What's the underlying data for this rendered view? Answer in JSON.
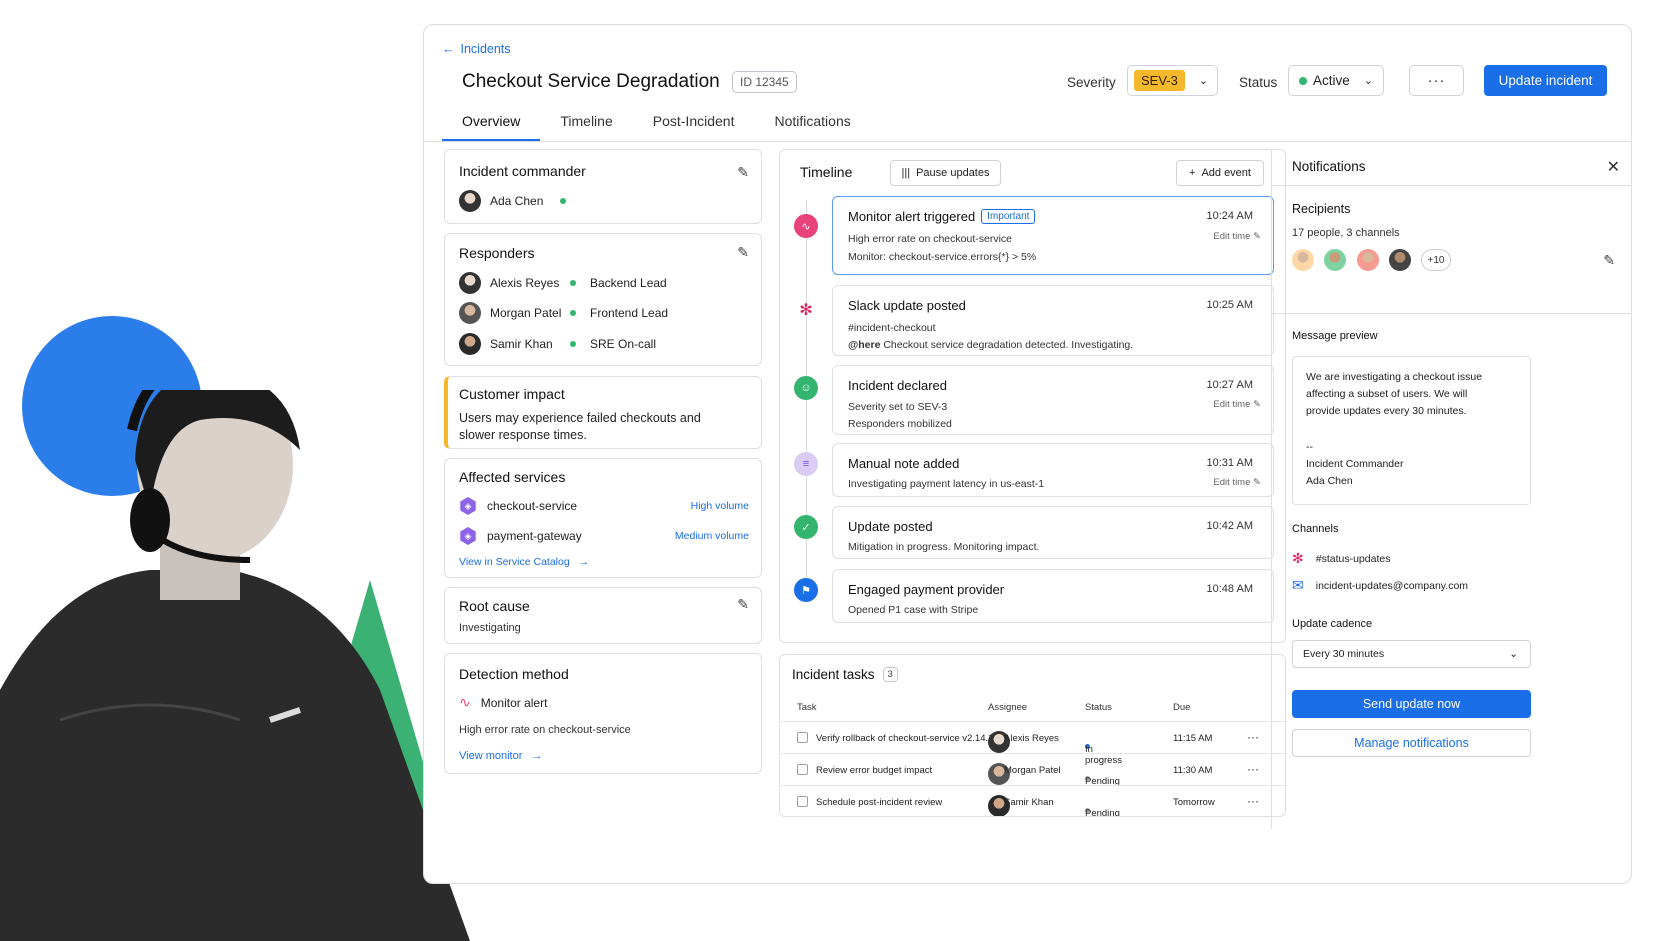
{
  "colors": {
    "accent": "#1a6ee8",
    "severity": "#f6b82b",
    "status_active": "#33b56f",
    "important": "#1a6ee8"
  },
  "header": {
    "back_link": "Incidents",
    "title": "Checkout Service Degradation",
    "id_badge": "ID 12345",
    "severity_label": "Severity",
    "severity_value": "SEV-3",
    "status_label": "Status",
    "status_value": "Active",
    "more_label": "···",
    "update_button": "Update incident"
  },
  "tabs": [
    "Overview",
    "Timeline",
    "Post-Incident",
    "Notifications"
  ],
  "commander": {
    "heading": "Incident commander",
    "name": "Ada Chen"
  },
  "responders": {
    "heading": "Responders",
    "people": [
      {
        "name": "Alexis Reyes",
        "role": "Backend Lead"
      },
      {
        "name": "Morgan Patel",
        "role": "Frontend Lead"
      },
      {
        "name": "Samir Khan",
        "role": "SRE On-call"
      }
    ]
  },
  "impact": {
    "heading": "Customer impact",
    "text1": "Users may experience failed checkouts and",
    "text2": "slower response times."
  },
  "affected": {
    "heading": "Affected services",
    "services": [
      {
        "name": "checkout-service",
        "volume": "High volume"
      },
      {
        "name": "payment-gateway",
        "volume": "Medium volume"
      }
    ],
    "catalog_link": "View in Service Catalog"
  },
  "root_cause": {
    "heading": "Root cause",
    "value": "Investigating"
  },
  "detection": {
    "heading": "Detection method",
    "method": "Monitor alert",
    "detail": "High error rate on checkout-service",
    "link": "View monitor"
  },
  "timeline": {
    "heading": "Timeline",
    "pause": "Pause updates",
    "add": "Add event",
    "edit_time": "Edit time",
    "events": [
      {
        "title": "Monitor alert triggered",
        "badge": "Important",
        "time": "10:24 AM",
        "line1": "High error rate on checkout-service",
        "line2": "Monitor: checkout-service.errors{*} > 5%"
      },
      {
        "title": "Slack update posted",
        "time": "10:25 AM",
        "line1": "#incident-checkout",
        "line2_bold": "@here",
        "line2": "Checkout service degradation detected. Investigating."
      },
      {
        "title": "Incident declared",
        "time": "10:27 AM",
        "line1": "Severity set to SEV-3",
        "line2": "Responders mobilized"
      },
      {
        "title": "Manual note added",
        "time": "10:31 AM",
        "line1": "Investigating payment latency in us-east-1"
      },
      {
        "title": "Update posted",
        "time": "10:42 AM",
        "line1": "Mitigation in progress. Monitoring impact."
      },
      {
        "title": "Engaged payment provider",
        "time": "10:48 AM",
        "line1": "Opened P1 case with Stripe"
      }
    ]
  },
  "tasks": {
    "heading": "Incident tasks",
    "count": "3",
    "columns": [
      "Task",
      "Assignee",
      "Status",
      "Due"
    ],
    "rows": [
      {
        "task": "Verify rollback of checkout-service v2.14.1",
        "assignee": "Alexis Reyes",
        "status": "In progress",
        "due": "11:15 AM"
      },
      {
        "task": "Review error budget impact",
        "assignee": "Morgan Patel",
        "status": "Pending",
        "due": "11:30 AM"
      },
      {
        "task": "Schedule post-incident review",
        "assignee": "Samir Khan",
        "status": "Pending",
        "due": "Tomorrow"
      }
    ],
    "row_more": "···"
  },
  "notifications": {
    "heading": "Notifications",
    "recipients_heading": "Recipients",
    "recipients_summary": "17 people, 3 channels",
    "more_count": "+10",
    "preview_heading": "Message preview",
    "preview_lines": [
      "We are investigating a checkout issue",
      "affecting a subset of users. We will",
      "provide updates every 30 minutes."
    ],
    "preview_sig": [
      "--",
      "Incident Commander",
      "Ada Chen"
    ],
    "channels_heading": "Channels",
    "channels": [
      "#status-updates",
      "incident-updates@company.com"
    ],
    "cadence_heading": "Update cadence",
    "cadence_value": "Every 30 minutes",
    "send_button": "Send update now",
    "manage_button": "Manage notifications"
  }
}
